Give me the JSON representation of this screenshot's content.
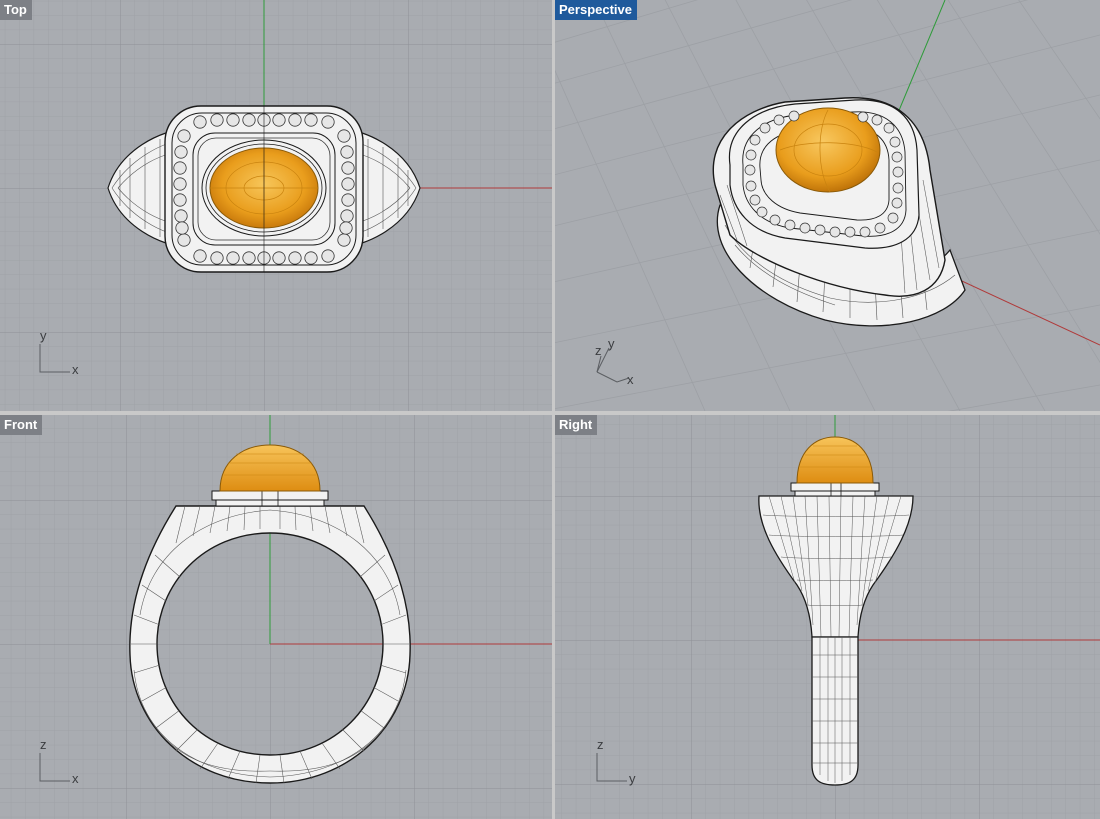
{
  "viewports": {
    "top": {
      "label": "Top",
      "active": false,
      "axis_h": "x",
      "axis_v": "y"
    },
    "perspective": {
      "label": "Perspective",
      "active": true,
      "axis_x": "x",
      "axis_y": "y",
      "axis_z": "z"
    },
    "front": {
      "label": "Front",
      "active": false,
      "axis_h": "x",
      "axis_v": "z"
    },
    "right": {
      "label": "Right",
      "active": false,
      "axis_h": "y",
      "axis_v": "z"
    }
  },
  "colors": {
    "viewport_bg": "#a9acb1",
    "grid_minor": "#9da0a5",
    "grid_major": "#8e9196",
    "axis_x": "#b03a3a",
    "axis_y": "#2f9b3a",
    "metal": "#f2f2f2",
    "stone": "#e8a021",
    "active_label_bg": "#1f5a9c",
    "label_bg": "#7d8086"
  },
  "icons": {
    "axis_widget": "axis-gizmo-icon"
  }
}
